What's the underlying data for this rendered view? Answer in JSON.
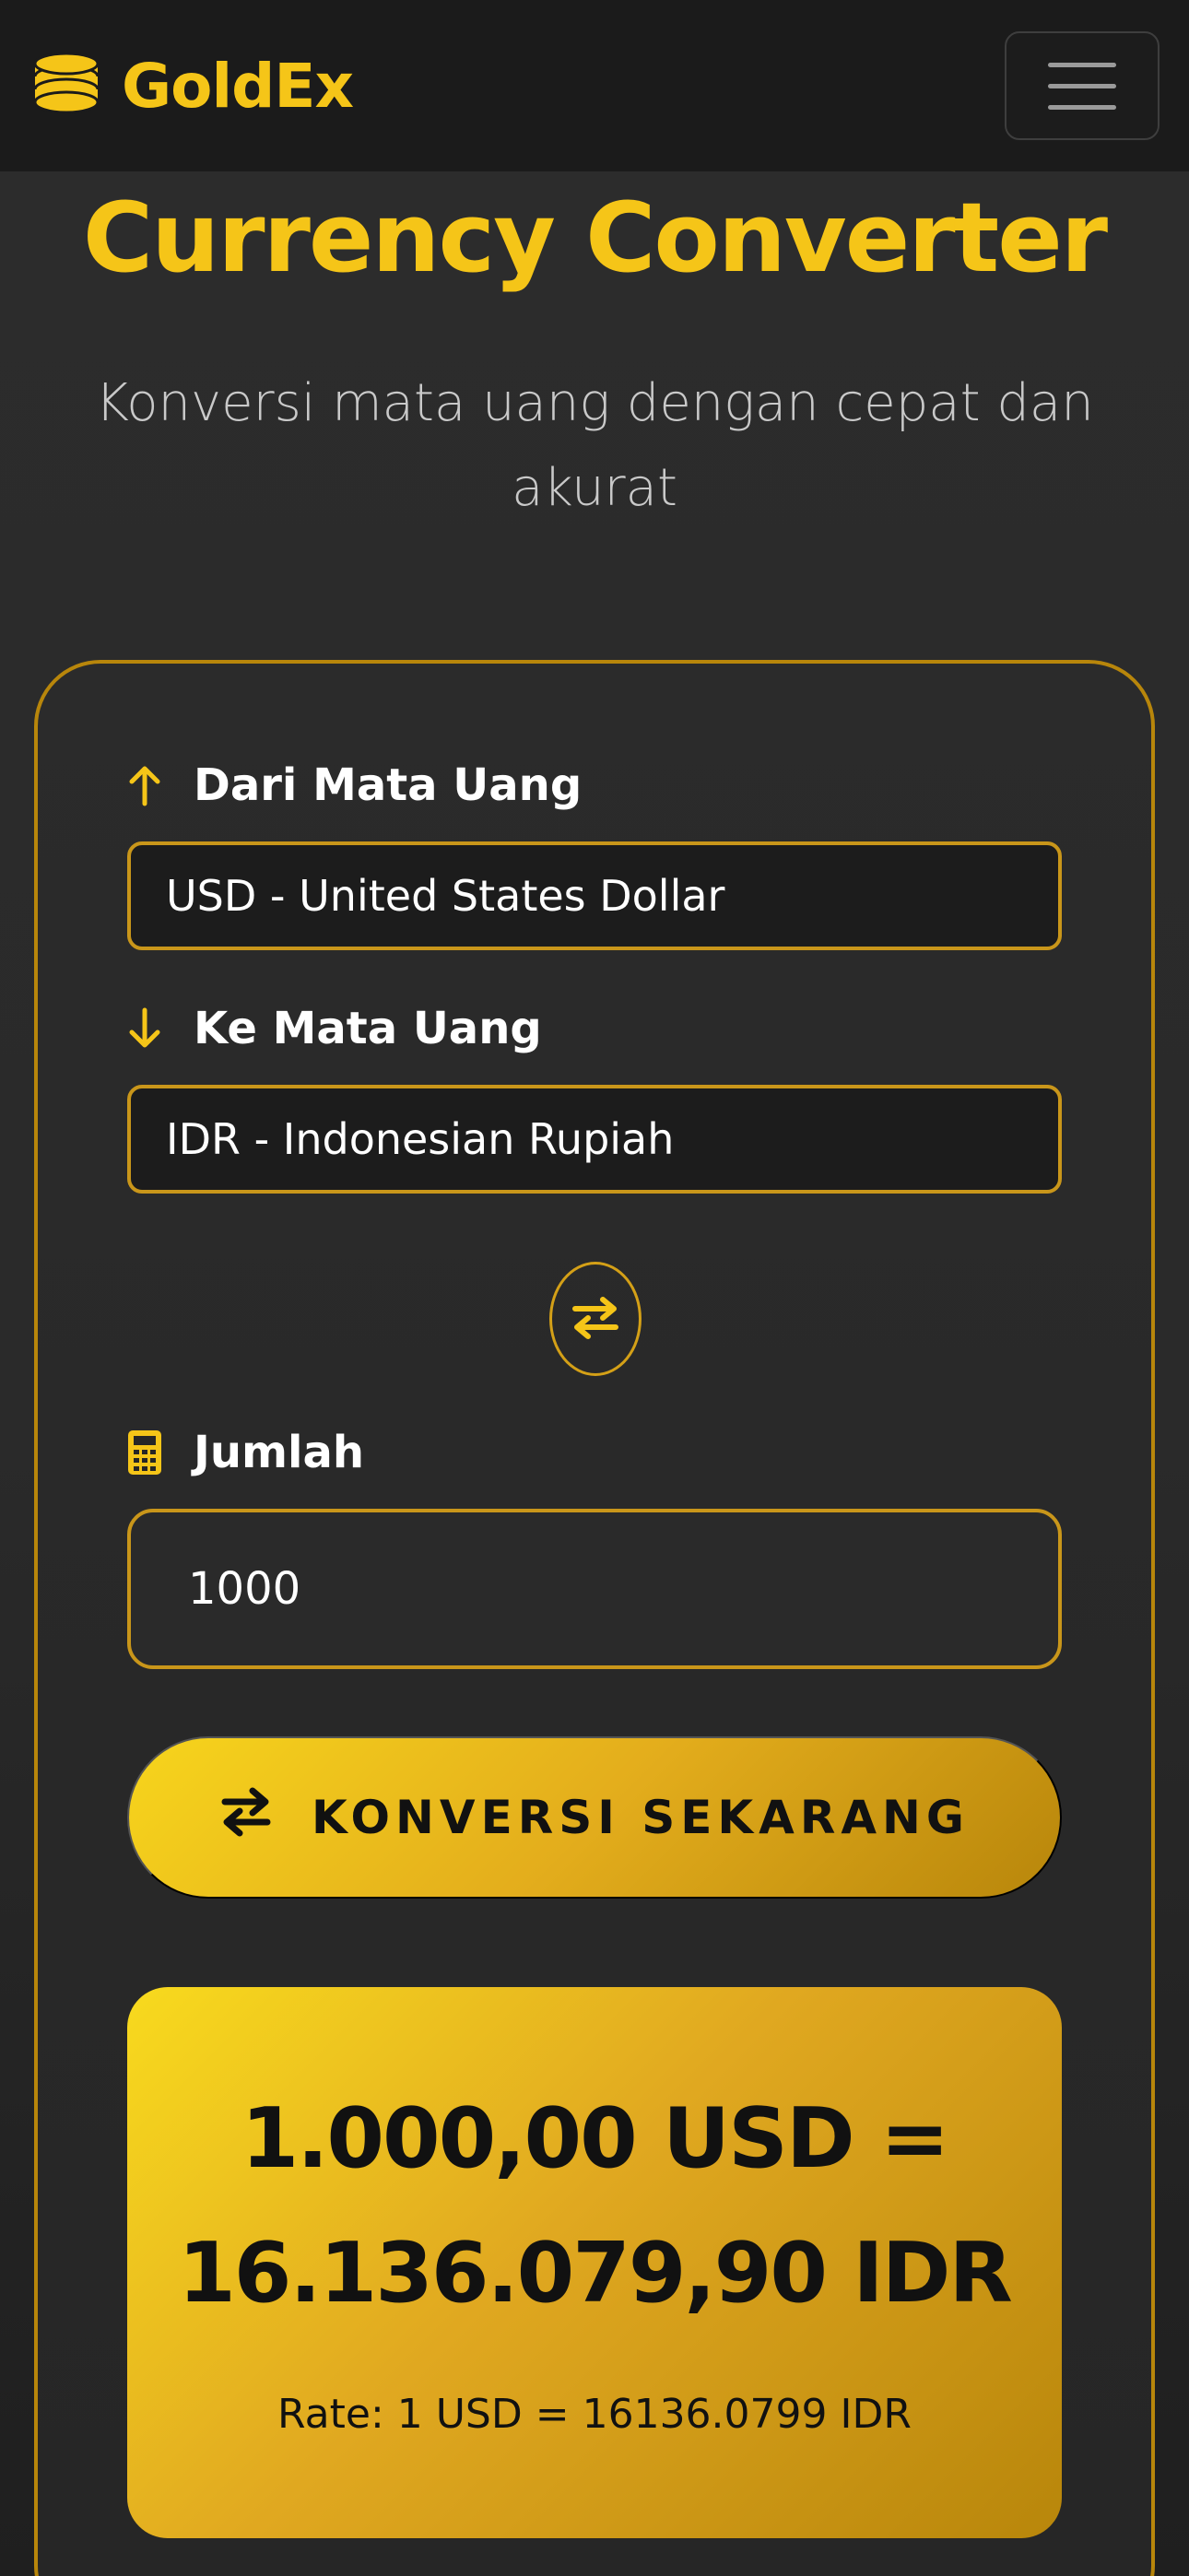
{
  "navbar": {
    "brand_name": "GoldEx",
    "brand_icon": "coins-icon",
    "menu_icon": "hamburger-menu-icon"
  },
  "hero": {
    "title": "Currency Converter",
    "subtitle": "Konversi mata uang dengan cepat dan akurat"
  },
  "converter": {
    "from": {
      "label": "Dari Mata Uang",
      "icon": "arrow-up-icon",
      "value": "USD - United States Dollar"
    },
    "to": {
      "label": "Ke Mata Uang",
      "icon": "arrow-down-icon",
      "value": "IDR - Indonesian Rupiah"
    },
    "swap_icon": "swap-arrows-icon",
    "amount": {
      "label": "Jumlah",
      "icon": "calculator-icon",
      "value": "1000"
    },
    "convert_button": {
      "label": "KONVERSI SEKARANG",
      "icon": "exchange-icon"
    },
    "result": {
      "line1": "1.000,00 USD =",
      "line2": "16.136.079,90 IDR",
      "rate": "Rate: 1 USD = 16136.0799 IDR"
    }
  },
  "colors": {
    "accent_gold": "#f5c518",
    "border_gold": "#b8860b",
    "navbar_bg": "#1b1b1b",
    "page_bg": "#2a2a2a"
  }
}
